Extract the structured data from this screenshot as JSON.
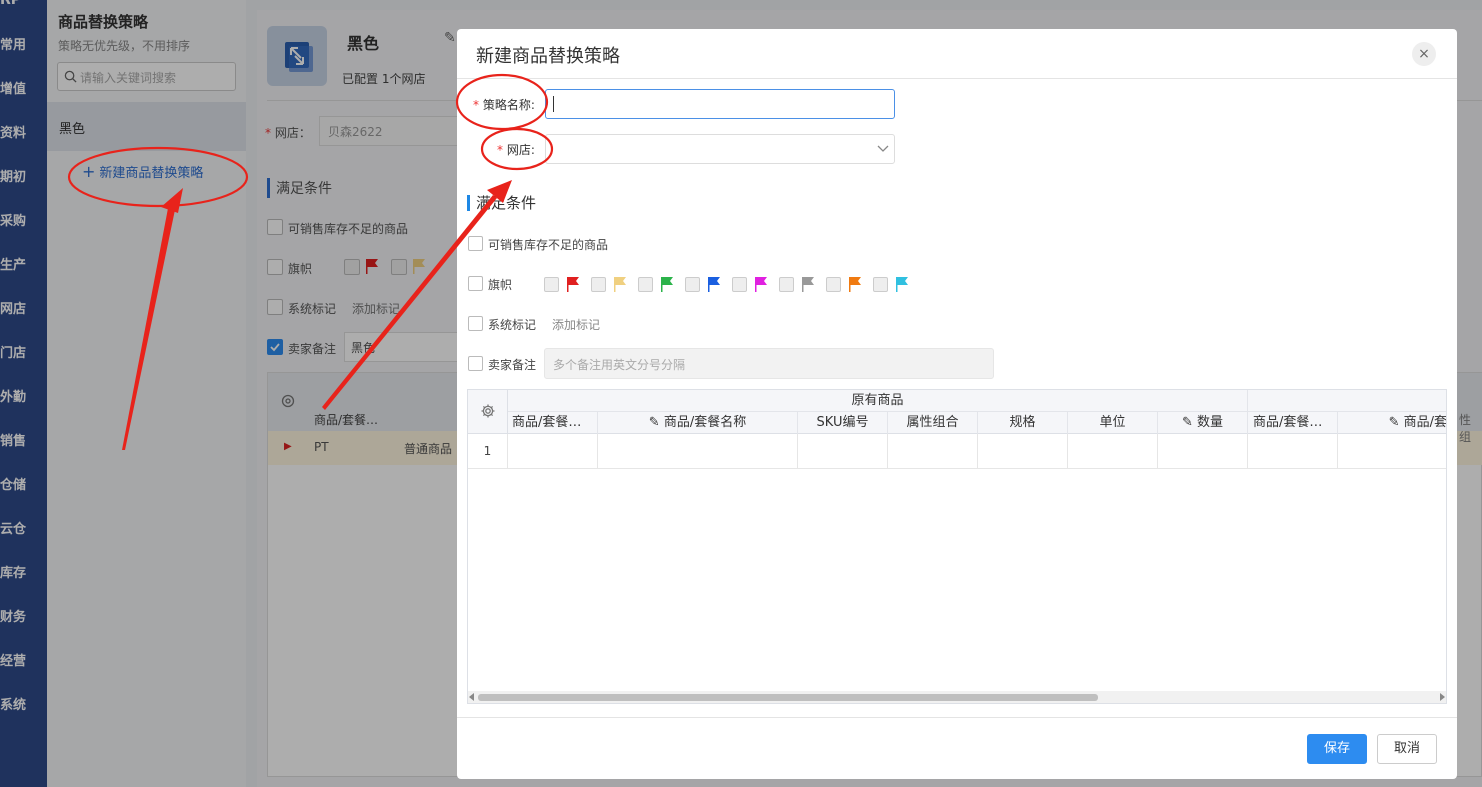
{
  "nav": {
    "brand": "RP",
    "items": [
      "常用",
      "增值",
      "资料",
      "期初",
      "采购",
      "生产",
      "网店",
      "门店",
      "外勤",
      "销售",
      "仓储",
      "云仓",
      "库存",
      "财务",
      "经营",
      "系统"
    ]
  },
  "list_panel": {
    "title": "商品替换策略",
    "subtitle": "策略无优先级，不用排序",
    "search_placeholder": "请输入关键词搜索",
    "items": [
      "黑色"
    ],
    "new_button": "新建商品替换策略",
    "new_plus": "+"
  },
  "detail": {
    "name": "黑色",
    "configured": "已配置  1个网店",
    "shop_label": "网店：",
    "shop_value": "贝森2622",
    "section": "满足条件",
    "cond_stock": "可销售库存不足的商品",
    "cond_flag": "旗帜",
    "cond_tag": "系统标记",
    "add_tag": "添加标记",
    "cond_remark": "卖家备注",
    "remark_value": "黑色",
    "table_col1": "商品/套餐…",
    "row_code": "PT",
    "row_type": "普通商品"
  },
  "modal": {
    "title": "新建商品替换策略",
    "close": "×",
    "name_label": "策略名称:",
    "shop_label": "网店:",
    "required_mark": "*",
    "section": "满足条件",
    "cond_stock": "可销售库存不足的商品",
    "cond_flag": "旗帜",
    "flag_colors": [
      "#e02020",
      "#f0d080",
      "#2bb34a",
      "#1a5fe0",
      "#e020e0",
      "#999999",
      "#f07a10",
      "#30c0e0"
    ],
    "cond_tag": "系统标记",
    "add_tag": "添加标记",
    "cond_remark": "卖家备注",
    "remark_placeholder": "多个备注用英文分号分隔",
    "grid": {
      "group_header": "原有商品",
      "columns": [
        "商品/套餐…",
        "商品/套餐名称",
        "SKU编号",
        "属性组合",
        "规格",
        "单位",
        "数量",
        "商品/套餐…",
        "商品/套"
      ],
      "trailing": "性组",
      "row_number": "1"
    },
    "save": "保存",
    "cancel": "取消"
  },
  "colors": {
    "nav_bg": "#2f4a8a",
    "accent": "#2d8cf0",
    "annotation": "#e8231b"
  }
}
